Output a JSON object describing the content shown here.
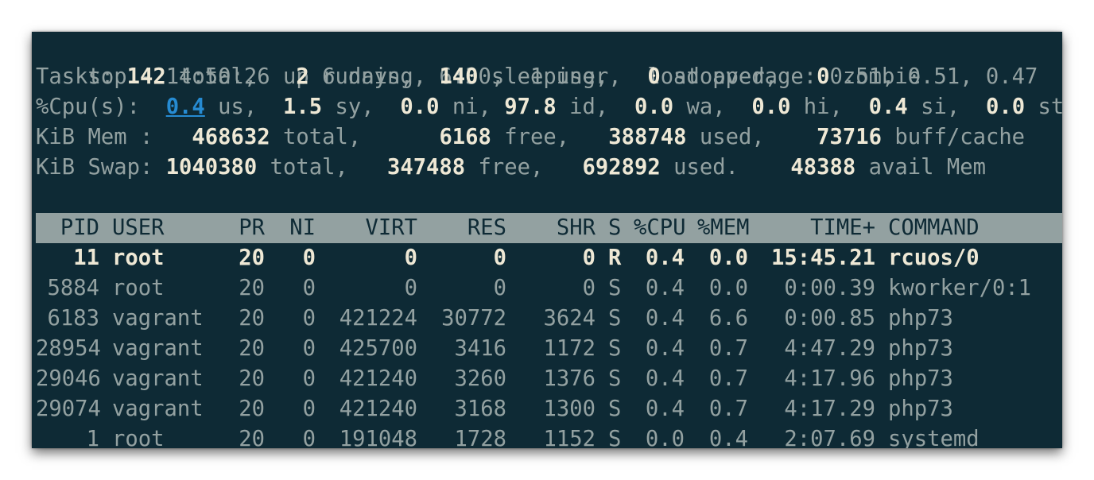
{
  "summary": {
    "line1": "top - 14:50:26 up 6 days,  6:30,  1 user,  load average: 0.51, 0.51, 0.47",
    "tasks": {
      "prefix": "Tasks: ",
      "total": "142",
      "total_label": " total,   ",
      "running": "2",
      "running_label": " running, ",
      "sleeping": "140",
      "sleeping_label": " sleeping,   ",
      "stopped": "0",
      "stopped_label": " stopped,   ",
      "zombie": "0",
      "zombie_label": " zombie"
    },
    "cpu": {
      "prefix": "%Cpu(s):  ",
      "us": "0.4",
      "us_label": " us,  ",
      "sy": "1.5",
      "sy_label": " sy,  ",
      "ni": "0.0",
      "ni_label": " ni, ",
      "id": "97.8",
      "id_label": " id,  ",
      "wa": "0.0",
      "wa_label": " wa,  ",
      "hi": "0.0",
      "hi_label": " hi,  ",
      "si": "0.4",
      "si_label": " si,  ",
      "st": "0.0",
      "st_label": " st"
    },
    "mem": {
      "prefix": "KiB Mem :   ",
      "total": "468632",
      "total_label": " total,      ",
      "free": "6168",
      "free_label": " free,   ",
      "used": "388748",
      "used_label": " used,    ",
      "cache": "73716",
      "cache_label": " buff/cache"
    },
    "swap": {
      "prefix": "KiB Swap: ",
      "total": "1040380",
      "total_label": " total,   ",
      "free": "347488",
      "free_label": " free,   ",
      "used": "692892",
      "used_label": " used.    ",
      "avail": "48388",
      "avail_label": " avail Mem"
    }
  },
  "table": {
    "headers": {
      "pid": "PID",
      "user": "USER",
      "pr": "PR",
      "ni": "NI",
      "virt": "VIRT",
      "res": "RES",
      "shr": "SHR",
      "s": "S",
      "cpu": "%CPU",
      "mem": "%MEM",
      "time": "TIME+",
      "command": "COMMAND"
    },
    "rows": [
      {
        "pid": "11",
        "user": "root",
        "pr": "20",
        "ni": "0",
        "virt": "0",
        "res": "0",
        "shr": "0",
        "s": "R",
        "cpu": "0.4",
        "mem": "0.0",
        "time": "15:45.21",
        "command": "rcuos/0"
      },
      {
        "pid": "5884",
        "user": "root",
        "pr": "20",
        "ni": "0",
        "virt": "0",
        "res": "0",
        "shr": "0",
        "s": "S",
        "cpu": "0.4",
        "mem": "0.0",
        "time": "0:00.39",
        "command": "kworker/0:1"
      },
      {
        "pid": "6183",
        "user": "vagrant",
        "pr": "20",
        "ni": "0",
        "virt": "421224",
        "res": "30772",
        "shr": "3624",
        "s": "S",
        "cpu": "0.4",
        "mem": "6.6",
        "time": "0:00.85",
        "command": "php73"
      },
      {
        "pid": "28954",
        "user": "vagrant",
        "pr": "20",
        "ni": "0",
        "virt": "425700",
        "res": "3416",
        "shr": "1172",
        "s": "S",
        "cpu": "0.4",
        "mem": "0.7",
        "time": "4:47.29",
        "command": "php73"
      },
      {
        "pid": "29046",
        "user": "vagrant",
        "pr": "20",
        "ni": "0",
        "virt": "421240",
        "res": "3260",
        "shr": "1376",
        "s": "S",
        "cpu": "0.4",
        "mem": "0.7",
        "time": "4:17.96",
        "command": "php73"
      },
      {
        "pid": "29074",
        "user": "vagrant",
        "pr": "20",
        "ni": "0",
        "virt": "421240",
        "res": "3168",
        "shr": "1300",
        "s": "S",
        "cpu": "0.4",
        "mem": "0.7",
        "time": "4:17.29",
        "command": "php73"
      },
      {
        "pid": "1",
        "user": "root",
        "pr": "20",
        "ni": "0",
        "virt": "191048",
        "res": "1728",
        "shr": "1152",
        "s": "S",
        "cpu": "0.0",
        "mem": "0.4",
        "time": "2:07.69",
        "command": "systemd"
      }
    ]
  },
  "colors": {
    "background": "#0e2a35",
    "text": "#93a1a1",
    "bold_text": "#eee8d5",
    "header_bar": "#93a1a1",
    "highlight": "#268bd2"
  }
}
